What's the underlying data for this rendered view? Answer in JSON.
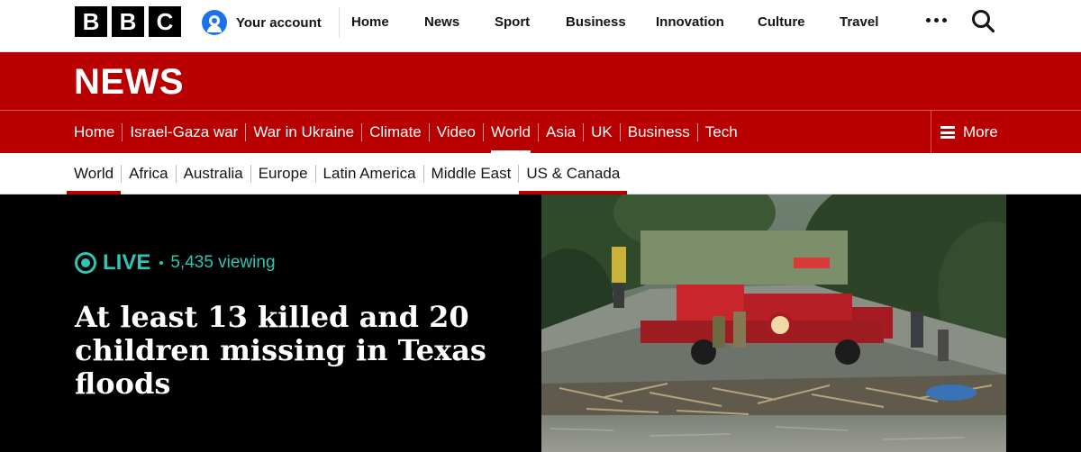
{
  "brand": {
    "letters": [
      "B",
      "B",
      "C"
    ]
  },
  "account": {
    "label": "Your account"
  },
  "topnav": [
    "Home",
    "News",
    "Sport",
    "Business",
    "Innovation",
    "Culture",
    "Travel"
  ],
  "section": {
    "title": "NEWS"
  },
  "news_nav": {
    "items": [
      "Home",
      "Israel-Gaza war",
      "War in Ukraine",
      "Climate",
      "Video",
      "World",
      "Asia",
      "UK",
      "Business",
      "Tech"
    ],
    "active": "World",
    "more_label": "More"
  },
  "subnav": {
    "items": [
      "World",
      "Africa",
      "Australia",
      "Europe",
      "Latin America",
      "Middle East",
      "US & Canada"
    ],
    "active": [
      "World",
      "US & Canada"
    ]
  },
  "hero": {
    "live_label": "LIVE",
    "viewing": "5,435 viewing",
    "headline": "At least 13 killed and 20 children missing in Texas floods"
  },
  "colors": {
    "brand_red": "#b80000",
    "live_teal": "#2ec4b6",
    "account_blue": "#1a73e8"
  }
}
